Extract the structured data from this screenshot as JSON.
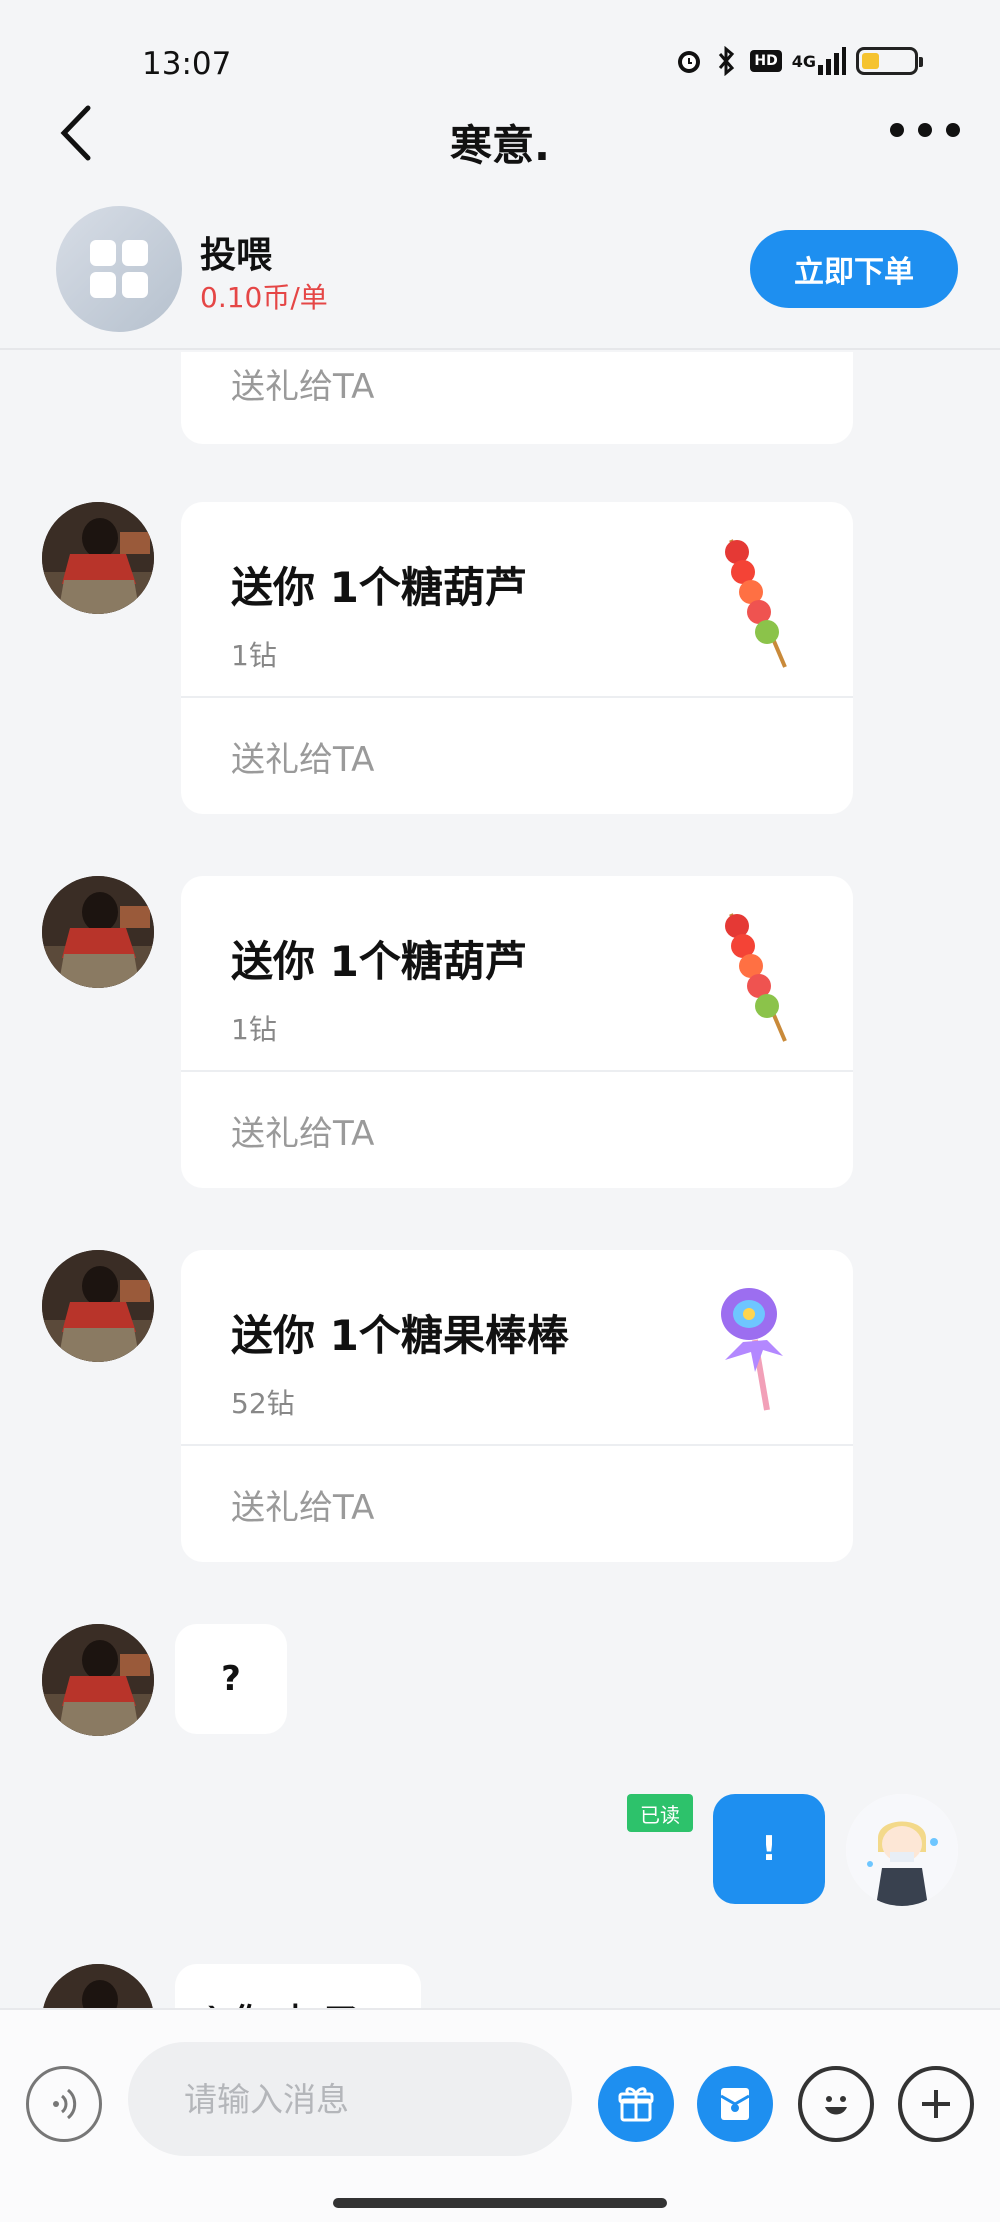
{
  "status_bar": {
    "time": "13:07",
    "hd": "HD",
    "network": "4G",
    "battery_level": 0.3,
    "icons": [
      "alarm-icon",
      "bluetooth-icon",
      "hd-icon",
      "signal-icon",
      "battery-icon"
    ]
  },
  "nav": {
    "title": "寒意.",
    "back_icon": "chevron-left-icon",
    "more_icon": "more-icon"
  },
  "service": {
    "name": "投喂",
    "price": "0.10币/单",
    "order_label": "立即下单"
  },
  "chat": {
    "partial_card": {
      "action": "送礼给TA"
    },
    "gift_cards": [
      {
        "title": "送你 1个糖葫芦",
        "price": "1钻",
        "action": "送礼给TA",
        "image": "candied-haws-icon"
      },
      {
        "title": "送你 1个糖葫芦",
        "price": "1钻",
        "action": "送礼给TA",
        "image": "candied-haws-icon"
      },
      {
        "title": "送你 1个糖果棒棒",
        "price": "52钻",
        "action": "送礼给TA",
        "image": "candy-wand-icon"
      }
    ],
    "incoming_text": "?",
    "outgoing_text": "!",
    "read_badge": "已读",
    "partial_text": "ì 你 来 了"
  },
  "input_bar": {
    "placeholder": "请输入消息",
    "icons": [
      "voice-icon",
      "gift-icon",
      "red-packet-icon",
      "emoji-icon",
      "plus-icon"
    ]
  },
  "colors": {
    "accent": "#1e8ff0",
    "price_red": "#e54646",
    "read_green": "#2dc26b",
    "background": "#f4f5f7"
  }
}
